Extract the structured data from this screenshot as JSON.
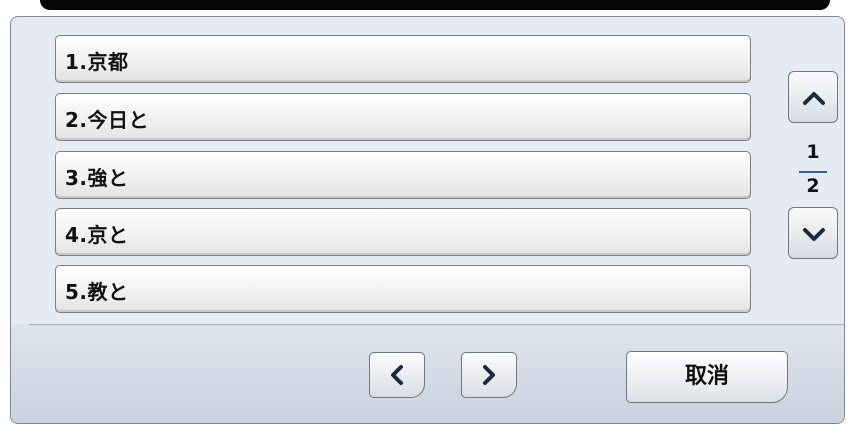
{
  "candidates": [
    {
      "label": "1.京都"
    },
    {
      "label": "2.今日と"
    },
    {
      "label": "3.強と"
    },
    {
      "label": "4.京と"
    },
    {
      "label": "5.教と"
    }
  ],
  "page": {
    "current": "1",
    "total": "2"
  },
  "buttons": {
    "cancel_label": "取消",
    "up_icon": "chevron-up-icon",
    "down_icon": "chevron-down-icon",
    "prev_icon": "chevron-left-icon",
    "next_icon": "chevron-right-icon"
  },
  "colors": {
    "panel_bg": "#e6eaf2",
    "page_divider": "#2c5fa8"
  }
}
